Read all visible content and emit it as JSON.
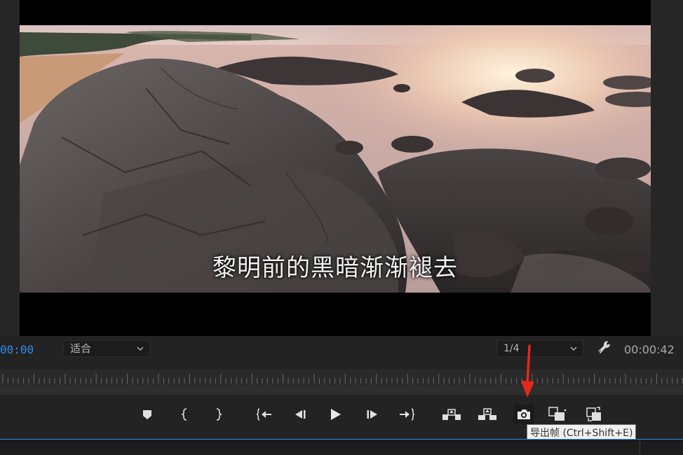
{
  "video": {
    "subtitle": "黎明前的黑暗渐渐褪去"
  },
  "monitor": {
    "timecode_current": "00:00",
    "fit_select_value": "适合",
    "resolution_select_value": "1/4",
    "timecode_duration": "00:00:42"
  },
  "transport": {
    "buttons": [
      {
        "name": "add-marker",
        "icon": "marker-icon"
      },
      {
        "name": "mark-in",
        "icon": "mark-in-icon"
      },
      {
        "name": "mark-out",
        "icon": "mark-out-icon"
      },
      {
        "name": "go-to-in",
        "icon": "go-to-in-icon"
      },
      {
        "name": "step-back",
        "icon": "step-back-icon"
      },
      {
        "name": "play",
        "icon": "play-icon"
      },
      {
        "name": "step-forward",
        "icon": "step-forward-icon"
      },
      {
        "name": "go-to-out",
        "icon": "go-to-out-icon"
      },
      {
        "name": "lift",
        "icon": "lift-icon"
      },
      {
        "name": "extract",
        "icon": "extract-icon"
      },
      {
        "name": "export-frame",
        "icon": "camera-icon"
      },
      {
        "name": "button-editor",
        "icon": "comparison-icon"
      },
      {
        "name": "toggle-proxies",
        "icon": "proxy-icon"
      }
    ],
    "tooltip": "导出帧 (Ctrl+Shift+E)"
  },
  "colors": {
    "accent": "#2d8ceb",
    "annotation_arrow": "#e8261c",
    "panel_bg": "#232323"
  }
}
